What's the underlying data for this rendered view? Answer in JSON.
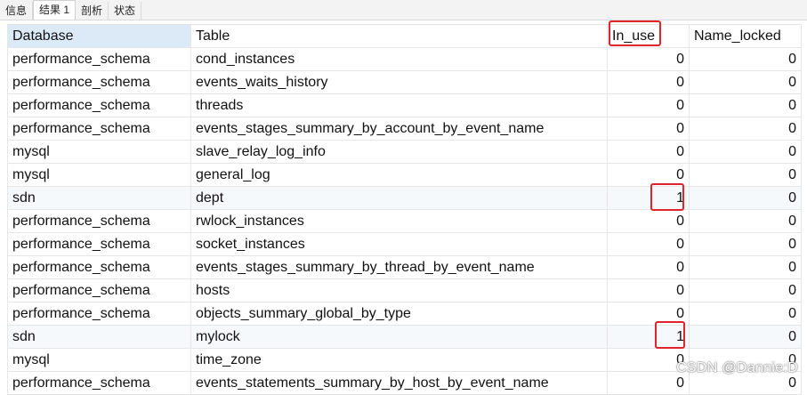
{
  "tabs": [
    {
      "label": "信息"
    },
    {
      "label": "结果 1"
    },
    {
      "label": "剖析"
    },
    {
      "label": "状态"
    }
  ],
  "table": {
    "columns": [
      "Database",
      "Table",
      "In_use",
      "Name_locked"
    ],
    "rows": [
      [
        "performance_schema",
        "cond_instances",
        "0",
        "0"
      ],
      [
        "performance_schema",
        "events_waits_history",
        "0",
        "0"
      ],
      [
        "performance_schema",
        "threads",
        "0",
        "0"
      ],
      [
        "performance_schema",
        "events_stages_summary_by_account_by_event_name",
        "0",
        "0"
      ],
      [
        "mysql",
        "slave_relay_log_info",
        "0",
        "0"
      ],
      [
        "mysql",
        "general_log",
        "0",
        "0"
      ],
      [
        "sdn",
        "dept",
        "1",
        "0"
      ],
      [
        "performance_schema",
        "rwlock_instances",
        "0",
        "0"
      ],
      [
        "performance_schema",
        "socket_instances",
        "0",
        "0"
      ],
      [
        "performance_schema",
        "events_stages_summary_by_thread_by_event_name",
        "0",
        "0"
      ],
      [
        "performance_schema",
        "hosts",
        "0",
        "0"
      ],
      [
        "performance_schema",
        "objects_summary_global_by_type",
        "0",
        "0"
      ],
      [
        "sdn",
        "mylock",
        "1",
        "0"
      ],
      [
        "mysql",
        "time_zone",
        "0",
        "0"
      ],
      [
        "performance_schema",
        "events_statements_summary_by_host_by_event_name",
        "0",
        "0"
      ]
    ]
  },
  "watermark": "CSDN @Dannie:D",
  "colors": {
    "highlight_box": "#e0242b",
    "header_selected": "#dceaf8"
  }
}
